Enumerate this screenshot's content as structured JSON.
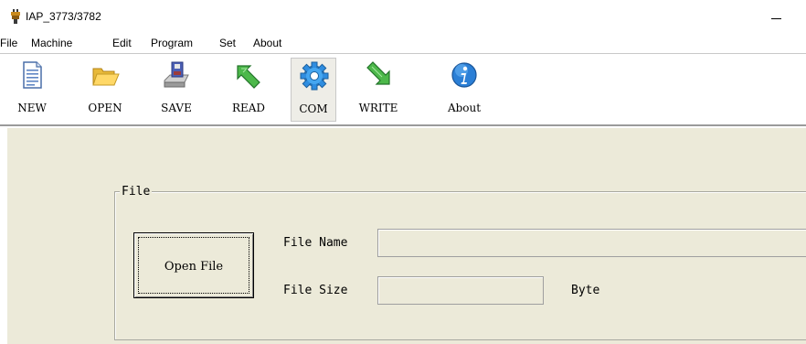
{
  "window": {
    "title": "IAP_3773/3782",
    "minimize_icon": "minimize-icon",
    "app_icon": "app-icon"
  },
  "menu": {
    "items": [
      {
        "label": "File"
      },
      {
        "label": "Machine"
      },
      {
        "label": "Edit"
      },
      {
        "label": "Program"
      },
      {
        "label": "Set"
      },
      {
        "label": "About"
      }
    ]
  },
  "toolbar": {
    "buttons": [
      {
        "label": "NEW",
        "icon": "new-file-icon"
      },
      {
        "label": "OPEN",
        "icon": "open-folder-icon"
      },
      {
        "label": "SAVE",
        "icon": "save-icon"
      },
      {
        "label": "READ",
        "icon": "read-arrow-icon"
      },
      {
        "label": "COM",
        "icon": "com-gear-icon"
      },
      {
        "label": "WRITE",
        "icon": "write-arrow-icon"
      },
      {
        "label": "About",
        "icon": "about-info-icon"
      }
    ],
    "active": "COM"
  },
  "file_group": {
    "title": "File",
    "open_button": "Open File",
    "file_name_label": "File Name",
    "file_name_value": "",
    "file_size_label": "File Size",
    "file_size_value": "",
    "byte_label": "Byte"
  },
  "colors": {
    "panel_bg": "#ecead9",
    "toolbar_bg": "#ffffff"
  }
}
